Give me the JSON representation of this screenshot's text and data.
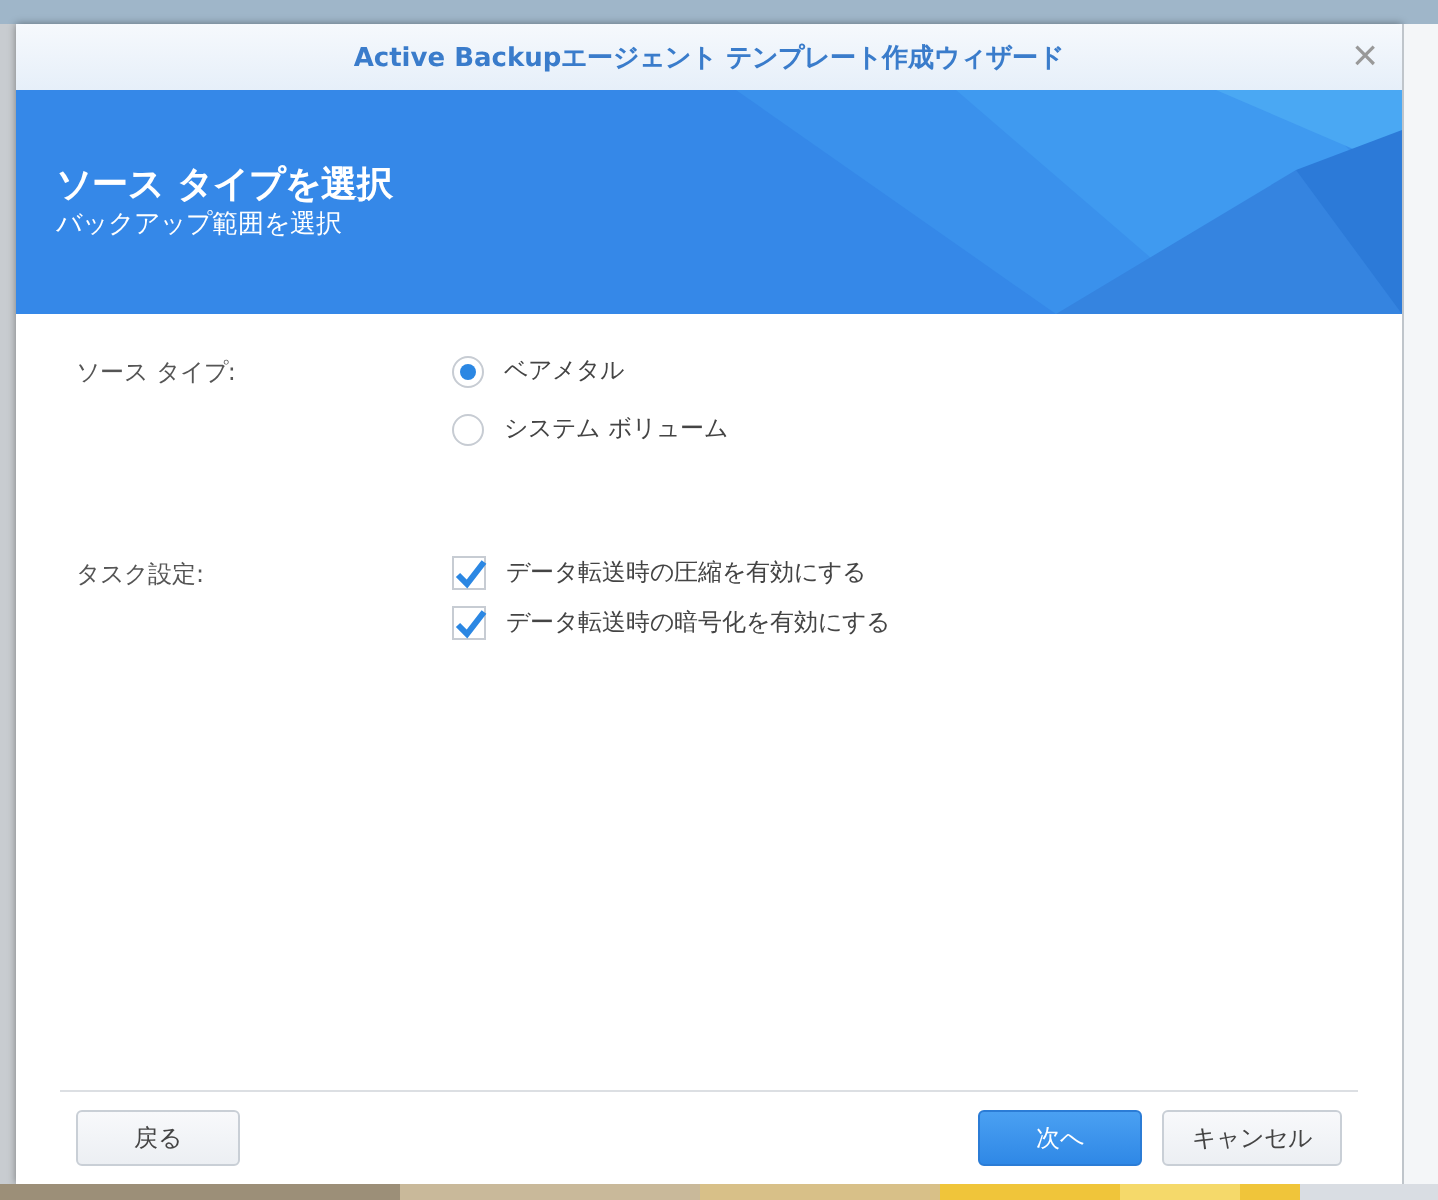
{
  "window": {
    "title": "Active Backupエージェント テンプレート作成ウィザード",
    "close": "×"
  },
  "header": {
    "title": "ソース タイプを選択",
    "subtitle": "バックアップ範囲を選択"
  },
  "source_type": {
    "label": "ソース タイプ:",
    "options": [
      {
        "label": "ベアメタル",
        "selected": true
      },
      {
        "label": "システム ボリューム",
        "selected": false
      }
    ]
  },
  "task_settings": {
    "label": "タスク設定:",
    "options": [
      {
        "label": "データ転送時の圧縮を有効にする",
        "checked": true
      },
      {
        "label": "データ転送時の暗号化を有効にする",
        "checked": true
      }
    ]
  },
  "buttons": [
    {
      "label": "戻る",
      "kind": "secondary"
    },
    {
      "label": "次へ",
      "kind": "primary"
    },
    {
      "label": "キャンセル",
      "kind": "secondary"
    }
  ]
}
